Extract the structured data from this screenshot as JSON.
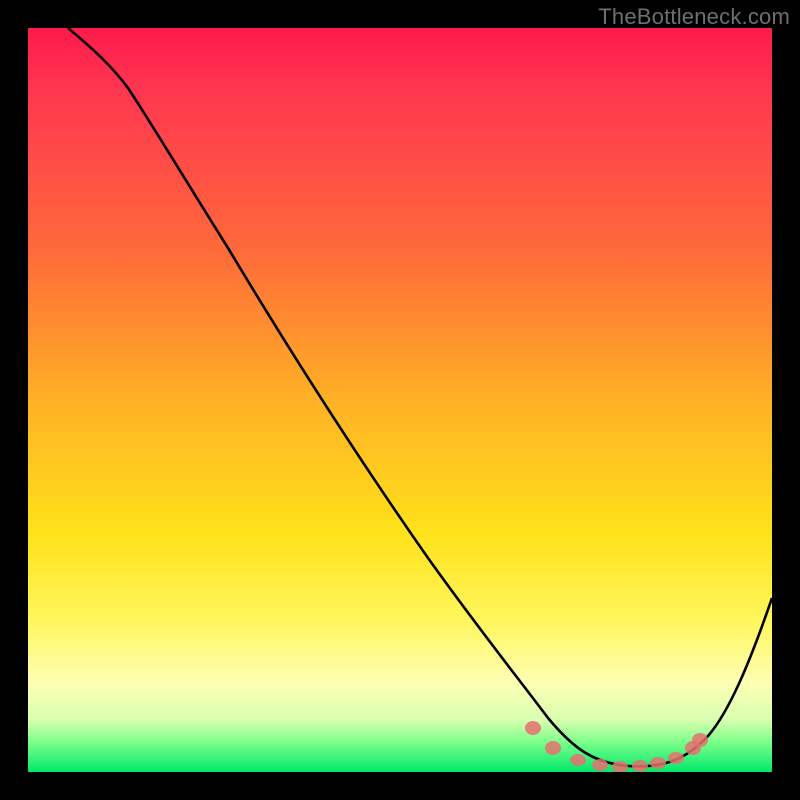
{
  "watermark": "TheBottleneck.com",
  "chart_data": {
    "type": "line",
    "title": "",
    "xlabel": "",
    "ylabel": "",
    "xlim": [
      0,
      100
    ],
    "ylim": [
      0,
      100
    ],
    "series": [
      {
        "name": "bottleneck-curve",
        "x": [
          0,
          8,
          14,
          20,
          30,
          40,
          50,
          60,
          66,
          70,
          74,
          78,
          82,
          86,
          90,
          94,
          100
        ],
        "values": [
          100,
          97,
          94,
          90,
          77,
          63,
          49,
          34,
          24,
          16,
          8,
          3,
          1,
          1,
          3,
          10,
          26
        ]
      }
    ],
    "markers": {
      "name": "highlight-dots",
      "x": [
        67,
        70,
        74,
        77,
        80,
        82,
        84,
        86,
        88,
        90
      ],
      "values": [
        12,
        6,
        3,
        2,
        1,
        1,
        1,
        1,
        4,
        9
      ]
    },
    "gradient_stops": [
      {
        "pos": 0.0,
        "color": "#ff1a4b"
      },
      {
        "pos": 0.5,
        "color": "#ffb125"
      },
      {
        "pos": 0.8,
        "color": "#fff760"
      },
      {
        "pos": 1.0,
        "color": "#00e86b"
      }
    ]
  }
}
